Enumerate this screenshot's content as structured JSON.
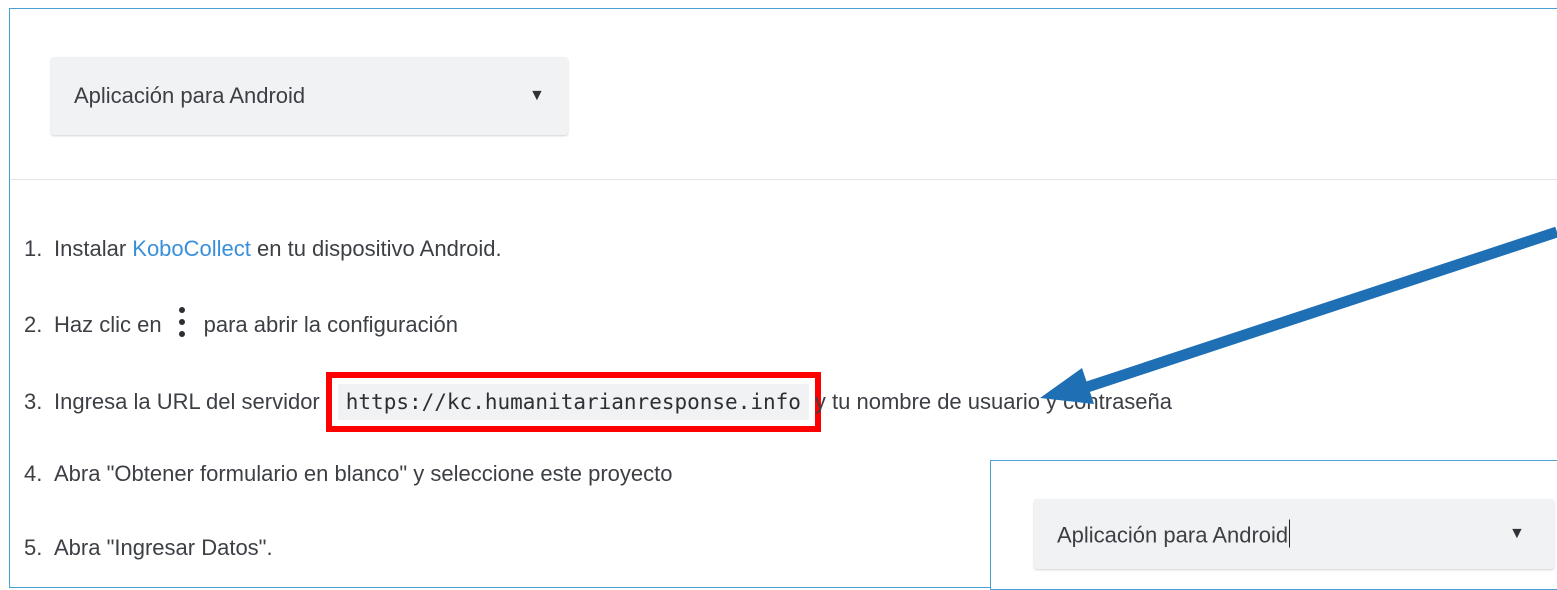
{
  "platform_select": {
    "value": "Aplicación para Android",
    "caret": "▼"
  },
  "steps": [
    {
      "num": "1.",
      "before": "Instalar ",
      "link": "KoboCollect",
      "after": " en tu dispositivo Android."
    },
    {
      "num": "2.",
      "before": "Haz clic en",
      "icon": "kebab-menu-icon",
      "after": "para abrir la configuración"
    },
    {
      "num": "3.",
      "before": "Ingresa la URL del servidor",
      "url": "https://kc.humanitarianresponse.info",
      "after": "y tu nombre de usuario y contraseña"
    },
    {
      "num": "4.",
      "text": "Abra \"Obtener formulario en blanco\" y seleccione este proyecto"
    },
    {
      "num": "5.",
      "text": "Abra \"Ingresar Datos\"."
    }
  ],
  "popup_select": {
    "value": "Aplicación para Android",
    "caret": "▼"
  },
  "colors": {
    "highlight": "#ff0000",
    "arrow": "#1f6fb5",
    "link": "#3a8fd9",
    "frame_border": "#4a9fd5"
  }
}
